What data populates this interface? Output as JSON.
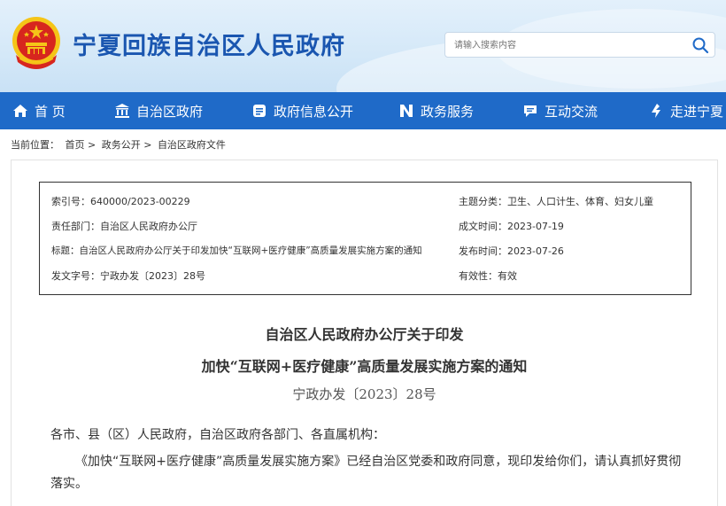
{
  "header": {
    "site_title": "宁夏回族自治区人民政府",
    "search": {
      "placeholder": "请输入搜索内容"
    }
  },
  "nav": [
    {
      "label": "首 页",
      "icon": "home-icon"
    },
    {
      "label": "自治区政府",
      "icon": "government-building-icon"
    },
    {
      "label": "政府信息公开",
      "icon": "document-icon"
    },
    {
      "label": "政务服务",
      "icon": "service-n-icon"
    },
    {
      "label": "互动交流",
      "icon": "chat-icon"
    },
    {
      "label": "走进宁夏",
      "icon": "location-icon"
    }
  ],
  "breadcrumb": {
    "prefix": "当前位置：",
    "items": [
      "首页",
      "政务公开",
      "自治区政府文件"
    ],
    "separator": ">"
  },
  "meta": {
    "index_label": "索引号：",
    "index_value": "640000/2023-00229",
    "subject_label": "主题分类：",
    "subject_value": "卫生、人口计生、体育、妇女儿童",
    "dept_label": "责任部门：",
    "dept_value": "自治区人民政府办公厅",
    "created_label": "成文时间：",
    "created_value": "2023-07-19",
    "title_label": "标题：",
    "title_value": "自治区人民政府办公厅关于印发加快“互联网+医疗健康”高质量发展实施方案的通知",
    "published_label": "发布时间：",
    "published_value": "2023-07-26",
    "docno_label": "发文字号：",
    "docno_value": "宁政办发〔2023〕28号",
    "validity_label": "有效性：",
    "validity_value": "有效"
  },
  "document": {
    "title_line1": "自治区人民政府办公厅关于印发",
    "title_line2": "加快“互联网+医疗健康”高质量发展实施方案的通知",
    "doc_number": "宁政办发〔2023〕28号",
    "salutation": "各市、县（区）人民政府，自治区政府各部门、各直属机构：",
    "body": "《加快“互联网+医疗健康”高质量发展实施方案》已经自治区党委和政府同意，现印发给你们，请认真抓好贯彻落实。"
  },
  "colors": {
    "brand_blue": "#1f6ac8",
    "title_blue": "#1a56b0",
    "emblem_red": "#d7261e",
    "emblem_gold": "#f5c518"
  }
}
